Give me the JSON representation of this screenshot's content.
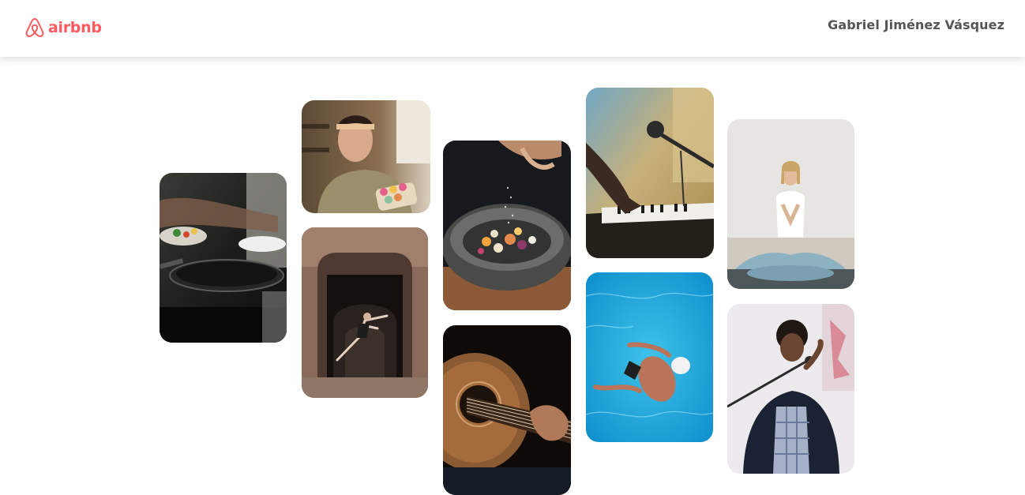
{
  "header": {
    "logo_text": "airbnb",
    "user_name": "Gabriel Jiménez Vásquez"
  },
  "colors": {
    "brand": "#ff5a5f",
    "text_muted": "#555555"
  },
  "gallery": {
    "photos": [
      {
        "subject": "cooking-pan"
      },
      {
        "subject": "woman-with-macarons"
      },
      {
        "subject": "dancer-in-doorway"
      },
      {
        "subject": "stone-bowl-dish"
      },
      {
        "subject": "acoustic-guitar"
      },
      {
        "subject": "piano-and-microphone"
      },
      {
        "subject": "swimmer-in-pool"
      },
      {
        "subject": "yoga-meditation"
      },
      {
        "subject": "singer-at-microphone"
      }
    ]
  }
}
